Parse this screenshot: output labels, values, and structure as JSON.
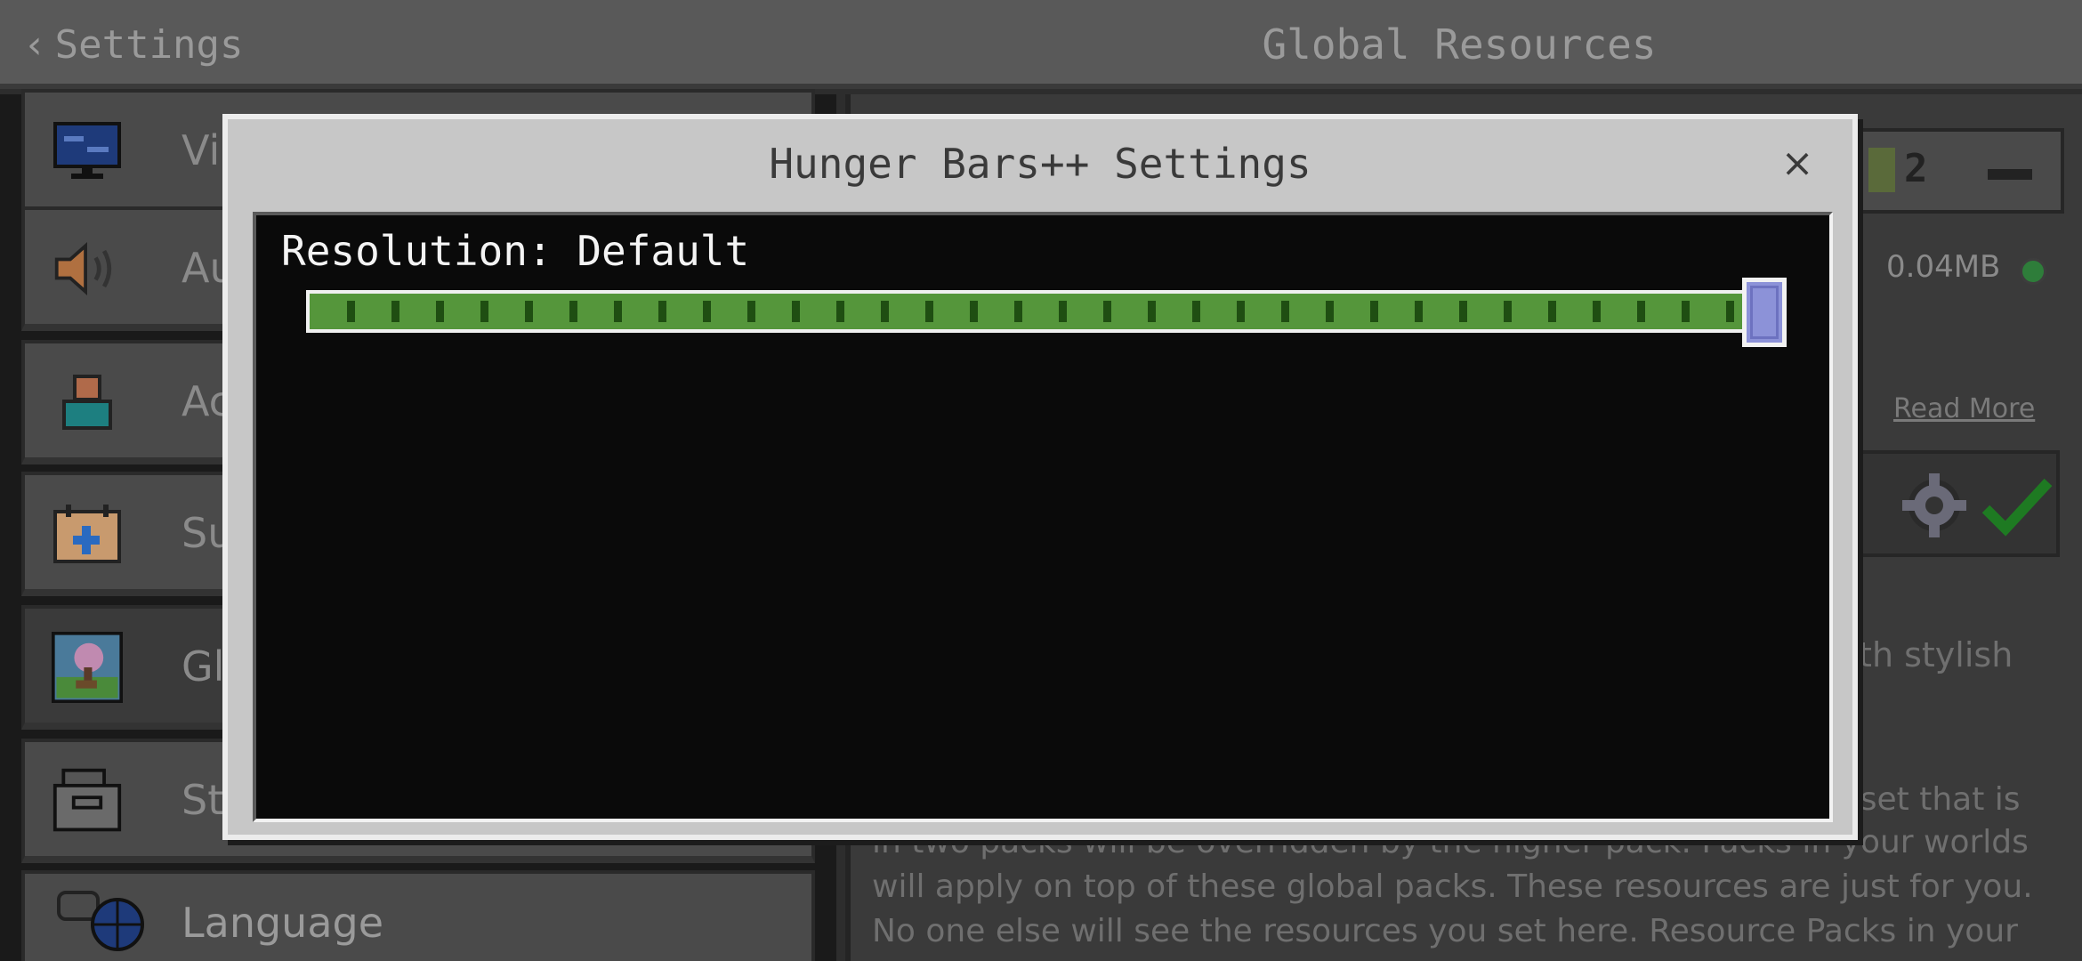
{
  "header": {
    "back_label": "Settings",
    "title": "Global Resources"
  },
  "sidebar": {
    "items": [
      {
        "label": "Vi",
        "icon": "monitor-icon"
      },
      {
        "label": "Au",
        "icon": "speaker-icon"
      },
      {
        "label": "Ac",
        "icon": "person-icon"
      },
      {
        "label": "Su",
        "icon": "calendar-plus-icon"
      },
      {
        "label": "Gl",
        "icon": "global-resources-icon",
        "selected": true
      },
      {
        "label": "St",
        "icon": "storage-box-icon"
      },
      {
        "label": "Language",
        "icon": "language-globe-icon"
      }
    ]
  },
  "pack": {
    "count": "2",
    "size": "0.04MB",
    "read_more": "Read More",
    "description_fragment": "vith stylish",
    "asset_fragment": "sset that is",
    "body_lines": [
      "in two packs will be overridden by the higher pack. Packs in your worlds",
      "will apply on top of these global packs. These resources are just for you.",
      "No one else will see the resources you set here. Resource Packs in your"
    ]
  },
  "modal": {
    "title": "Hunger Bars++ Settings",
    "close_label": "×",
    "resolution_label": "Resolution: Default",
    "slider_value": 1.0
  },
  "colors": {
    "modal_bg": "#c7c7c7",
    "panel_bg": "#0a0a0a",
    "slider_fill": "#55963b",
    "slider_tick": "#1f4e12",
    "slider_thumb": "#8c92d8",
    "status_green": "#2e7d3a"
  }
}
